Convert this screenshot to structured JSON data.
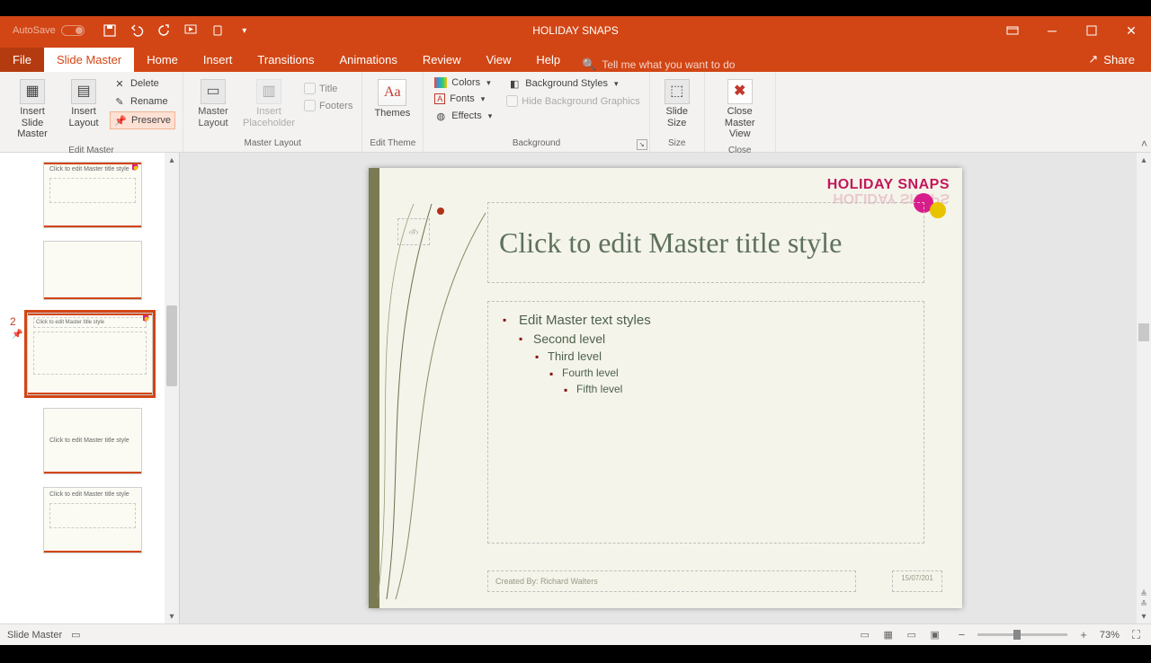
{
  "titlebar": {
    "autosave_label": "AutoSave",
    "title": "HOLIDAY SNAPS"
  },
  "tabs": {
    "file": "File",
    "slide_master": "Slide Master",
    "home": "Home",
    "insert": "Insert",
    "transitions": "Transitions",
    "animations": "Animations",
    "review": "Review",
    "view": "View",
    "help": "Help",
    "search_placeholder": "Tell me what you want to do",
    "share": "Share"
  },
  "ribbon": {
    "edit_master": {
      "insert_slide_master": "Insert Slide Master",
      "insert_layout": "Insert Layout",
      "delete": "Delete",
      "rename": "Rename",
      "preserve": "Preserve",
      "group": "Edit Master"
    },
    "master_layout": {
      "master_layout": "Master Layout",
      "insert_placeholder": "Insert Placeholder",
      "title": "Title",
      "footers": "Footers",
      "group": "Master Layout"
    },
    "edit_theme": {
      "themes": "Themes",
      "group": "Edit Theme"
    },
    "background": {
      "colors": "Colors",
      "fonts": "Fonts",
      "effects": "Effects",
      "bg_styles": "Background Styles",
      "hide_bg": "Hide Background Graphics",
      "group": "Background"
    },
    "size": {
      "slide_size": "Slide Size",
      "group": "Size"
    },
    "close": {
      "close_master": "Close Master View",
      "group": "Close"
    }
  },
  "thumbs": {
    "selected_index": "2"
  },
  "slide": {
    "logo": "HOLIDAY SNAPS",
    "slot_num": "‹#›",
    "title": "Click to edit Master title style",
    "body": {
      "l1": "Edit Master text styles",
      "l2": "Second level",
      "l3": "Third level",
      "l4": "Fourth level",
      "l5": "Fifth level"
    },
    "footer": "Created By: Richard Walters",
    "date": "15/07/201"
  },
  "statusbar": {
    "mode": "Slide Master",
    "zoom": "73%"
  }
}
